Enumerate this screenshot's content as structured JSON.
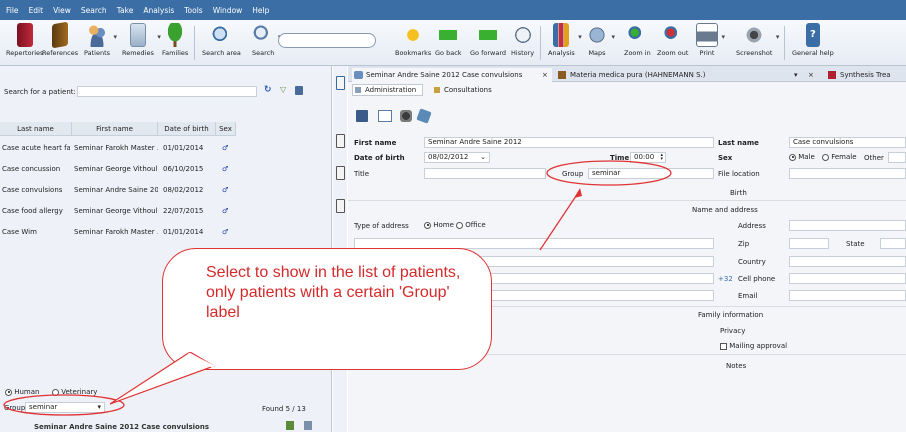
{
  "menu": [
    "File",
    "Edit",
    "View",
    "Search",
    "Take",
    "Analysis",
    "Tools",
    "Window",
    "Help"
  ],
  "toolbar": {
    "repertories": "Repertories",
    "references": "References",
    "patients": "Patients",
    "remedies": "Remedies",
    "families": "Families",
    "search_area": "Search area",
    "search": "Search",
    "bookmarks": "Bookmarks",
    "go_back": "Go back",
    "go_forward": "Go forward",
    "history": "History",
    "analysis": "Analysis",
    "maps": "Maps",
    "zoom_in": "Zoom in",
    "zoom_out": "Zoom out",
    "print": "Print",
    "screenshot": "Screenshot",
    "general_help": "General help"
  },
  "left": {
    "search_label": "Search for a patient:",
    "columns": [
      "Last name",
      "First name",
      "Date of birth",
      "Sex"
    ],
    "rows": [
      {
        "last": "Case acute heart fal...",
        "first": "Seminar Farokh Master ...",
        "dob": "01/01/2014",
        "sex": "♂"
      },
      {
        "last": "Case concussion",
        "first": "Seminar George Vithoul...",
        "dob": "06/10/2015",
        "sex": "♂"
      },
      {
        "last": "Case convulsions",
        "first": "Seminar Andre Saine 20...",
        "dob": "08/02/2012",
        "sex": "♂"
      },
      {
        "last": "Case food allergy",
        "first": "Seminar George Vithoul...",
        "dob": "22/07/2015",
        "sex": "♂"
      },
      {
        "last": "Case Wim",
        "first": "Seminar Farokh Master ...",
        "dob": "01/01/2014",
        "sex": "♂"
      }
    ],
    "human": "Human",
    "veterinary": "Veterinary",
    "group_label": "Group",
    "group_value": "seminar",
    "found": "Found 5 / 13",
    "footer_name": "Seminar Andre Saine 2012 Case convulsions"
  },
  "right": {
    "tabs": [
      {
        "label": "Seminar Andre Saine 2012 Case convulsions",
        "close": "×"
      },
      {
        "label": "Materia medica pura (HAHNEMANN S.)",
        "close": "×"
      },
      {
        "label": "Synthesis Trea"
      }
    ],
    "tab_dropdown": "▾",
    "subtabs": [
      "Administration",
      "Consultations"
    ],
    "first_name_label": "First name",
    "first_name": "Seminar Andre Saine 2012",
    "last_name_label": "Last name",
    "last_name": "Case convulsions",
    "dob_label": "Date of birth",
    "dob": "08/02/2012",
    "time_label": "Time",
    "time": "00:00",
    "sex_label": "Sex",
    "sex_options": [
      "Male",
      "Female",
      "Other"
    ],
    "title_label": "Title",
    "group_label": "Group",
    "group_value": "seminar",
    "file_location_label": "File location",
    "birth_label": "Birth",
    "name_address_label": "Name and address",
    "type_of_address_label": "Type of address",
    "address_types": [
      "Home",
      "Office"
    ],
    "address_label": "Address",
    "zip_label": "Zip",
    "state_label": "State",
    "country_label": "Country",
    "cell_phone_label": "Cell phone",
    "cell_prefix": "+32",
    "email_label": "Email",
    "family_info_label": "Family information",
    "privacy_label": "Privacy",
    "mailing_approval_label": "Mailing approval",
    "notes_label": "Notes"
  },
  "callout": "Select to show in the list of patients, only patients with a certain 'Group' label",
  "colors": {
    "menubar": "#3a6ea5",
    "annotation": "#e03333",
    "male": "#1a3fb0"
  }
}
